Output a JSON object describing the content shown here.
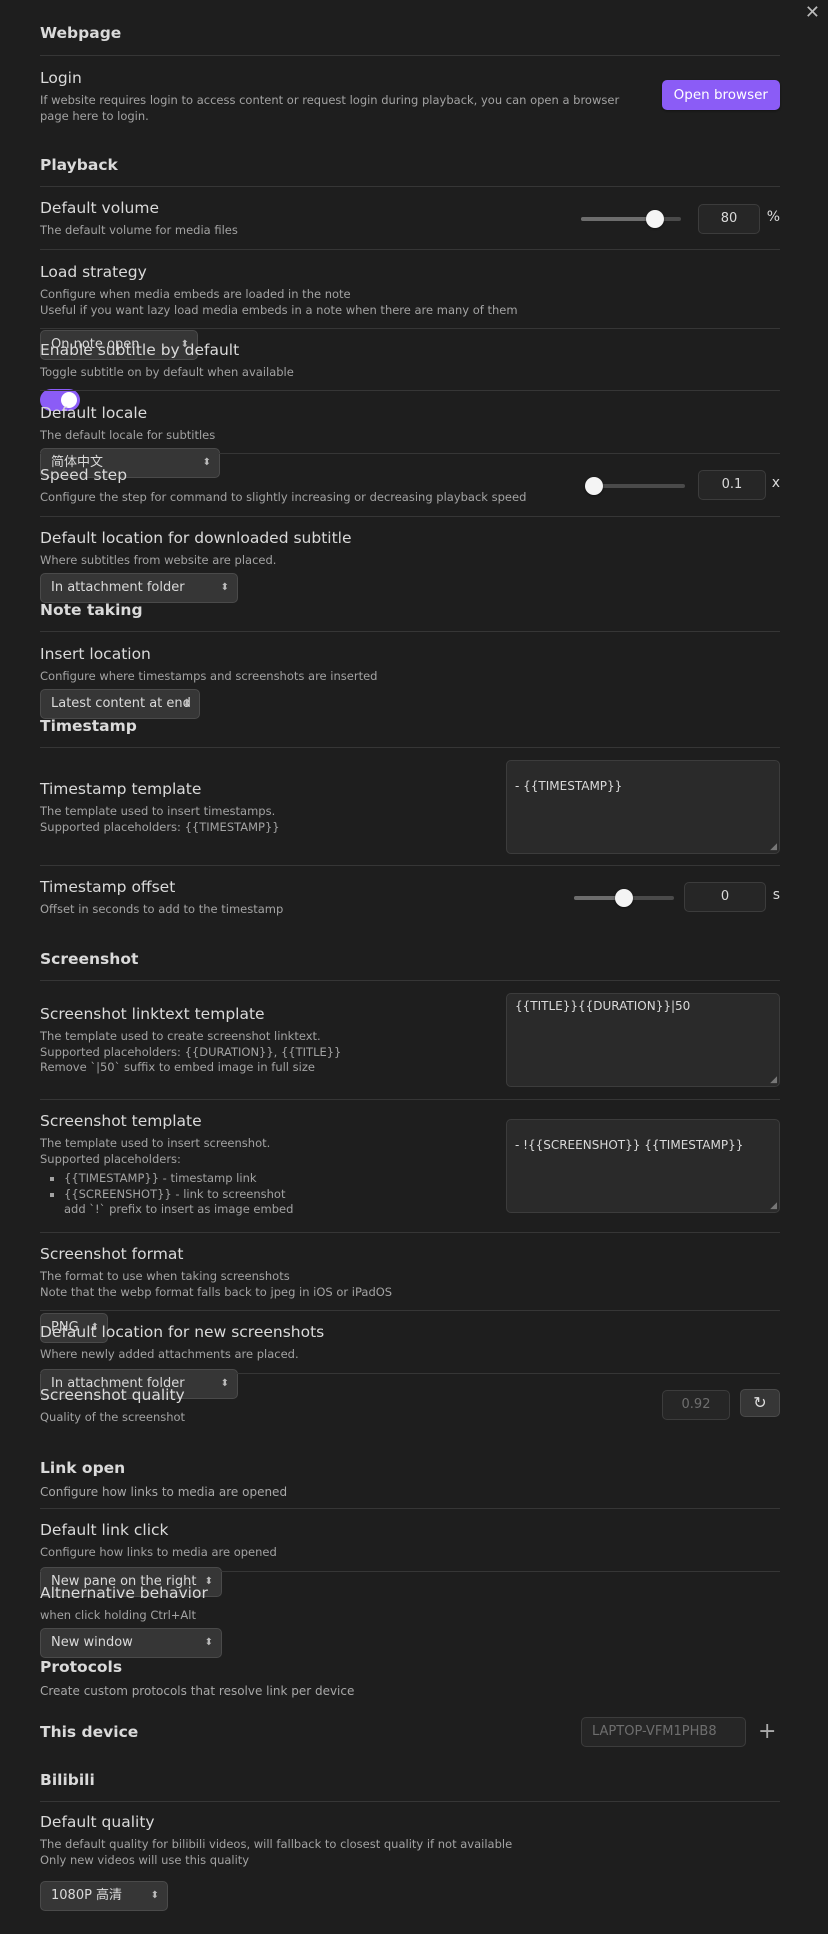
{
  "close_label": "✕",
  "webpage": {
    "heading": "Webpage",
    "login": {
      "name": "Login",
      "desc": "If website requires login to access content or request login during playback, you can open a browser page here to login.",
      "button": "Open browser"
    }
  },
  "playback": {
    "heading": "Playback",
    "volume": {
      "name": "Default volume",
      "desc": "The default volume for media files",
      "value": "80",
      "unit": "%",
      "level": 0.8
    },
    "load_strategy": {
      "name": "Load strategy",
      "desc1": "Configure when media embeds are loaded in the note",
      "desc2": "Useful if you want lazy load media embeds in a note when there are many of them",
      "value": "On note open"
    },
    "subtitle": {
      "name": "Enable subtitle by default",
      "desc": "Toggle subtitle on by default when available",
      "enabled": true
    },
    "locale": {
      "name": "Default locale",
      "desc": "The default locale for subtitles",
      "value": "简体中文"
    },
    "speed_step": {
      "name": "Speed step",
      "desc": "Configure the step for command to slightly increasing or decreasing playback speed",
      "value": "0.1",
      "unit": "x",
      "level": 0
    },
    "subtitle_location": {
      "name": "Default location for downloaded subtitle",
      "desc": "Where subtitles from website are placed.",
      "value": "In attachment folder"
    }
  },
  "note_taking": {
    "heading": "Note taking",
    "insert_location": {
      "name": "Insert location",
      "desc": "Configure where timestamps and screenshots are inserted",
      "value": "Latest content at end"
    }
  },
  "timestamp": {
    "heading": "Timestamp",
    "template": {
      "name": "Timestamp template",
      "desc1": "The template used to insert timestamps.",
      "desc2": "Supported placeholders: {{TIMESTAMP}}",
      "value": "- {{TIMESTAMP}}"
    },
    "offset": {
      "name": "Timestamp offset",
      "desc": "Offset in seconds to add to the timestamp",
      "value": "0",
      "unit": "s",
      "level": 0.5
    }
  },
  "screenshot": {
    "heading": "Screenshot",
    "linktext": {
      "name": "Screenshot linktext template",
      "desc1": "The template used to create screenshot linktext.",
      "desc2": "Supported placeholders: {{DURATION}}, {{TITLE}}",
      "desc3": "Remove `|50` suffix to embed image in full size",
      "value": "{{TITLE}}{{DURATION}}|50"
    },
    "template": {
      "name": "Screenshot template",
      "desc1": "The template used to insert screenshot.",
      "desc2": "Supported placeholders:",
      "item1": "{{TIMESTAMP}} - timestamp link",
      "item2a": "{{SCREENSHOT}} - link to screenshot",
      "item2b": "add `!` prefix to insert as image embed",
      "value": "- !{{SCREENSHOT}} {{TIMESTAMP}}"
    },
    "format": {
      "name": "Screenshot format",
      "desc1": "The format to use when taking screenshots",
      "desc2": "Note that the webp format falls back to jpeg in iOS or iPadOS",
      "value": "PNG"
    },
    "location": {
      "name": "Default location for new screenshots",
      "desc": "Where newly added attachments are placed.",
      "value": "In attachment folder"
    },
    "quality": {
      "name": "Screenshot quality",
      "desc": "Quality of the screenshot",
      "placeholder": "0.92"
    }
  },
  "link_open": {
    "heading": "Link open",
    "sub": "Configure how links to media are opened",
    "default_click": {
      "name": "Default link click",
      "desc": "Configure how links to media are opened",
      "value": "New pane on the right"
    },
    "alternative": {
      "name": "Altnernative behavior",
      "desc": "when click holding Ctrl+Alt",
      "value": "New window"
    }
  },
  "protocols": {
    "heading": "Protocols",
    "sub": "Create custom protocols that resolve link per device",
    "device_label": "This device",
    "device_placeholder": "LAPTOP-VFM1PHB8"
  },
  "bilibili": {
    "heading": "Bilibili",
    "quality": {
      "name": "Default quality",
      "desc1": "The default quality for bilibili videos, will fallback to closest quality if not available",
      "desc2": "Only new videos will use this quality",
      "value": "1080P 高清"
    }
  },
  "colors": {
    "accent": "#8b5cf6",
    "background": "#1e1e1e"
  }
}
